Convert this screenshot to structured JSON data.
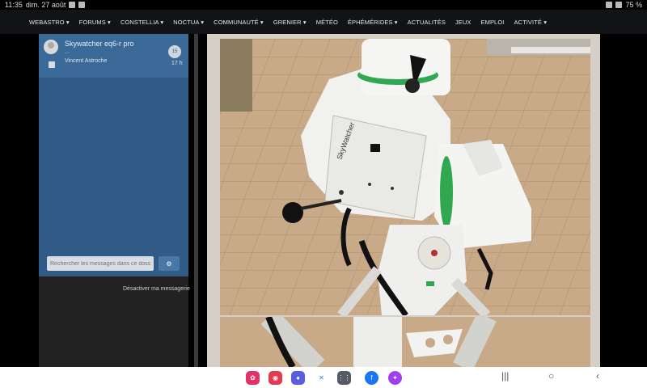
{
  "status": {
    "time": "11:35",
    "date": "dim. 27 août",
    "battery": "75 %"
  },
  "nav": {
    "items": [
      "WEBASTRO ▾",
      "FORUMS ▾",
      "CONSTELLIA ▾",
      "NOCTUA ▾",
      "COMMUNAUTÉ ▾",
      "GRENIER ▾",
      "MÉTÉO",
      "ÉPHÉMÉRIDES ▾",
      "ACTUALITÉS",
      "JEUX",
      "EMPLOI",
      "ACTIVITÉ ▾"
    ]
  },
  "chat": {
    "conversation": {
      "title": "Skywatcher eq6-r pro",
      "snippet": "...",
      "author": "Vincent Astroche",
      "badge": "15",
      "time": "17 h"
    },
    "search": {
      "placeholder": "Rechercher les messages dans ce dossier"
    },
    "disable_link": "Désactiver ma messagerie"
  },
  "icons": {
    "search": "gear-icon",
    "avatar": "user-icon"
  },
  "dock": {
    "apps": [
      "flower-app-icon",
      "camera-app-icon",
      "messages-app-icon",
      "link-app-icon",
      "grid-app-icon",
      "facebook-app-icon",
      "messenger-app-icon"
    ]
  },
  "colors": {
    "chat_panel": "#2f5b86",
    "nav_bg": "#111317",
    "accent_green": "#2fa84f"
  }
}
